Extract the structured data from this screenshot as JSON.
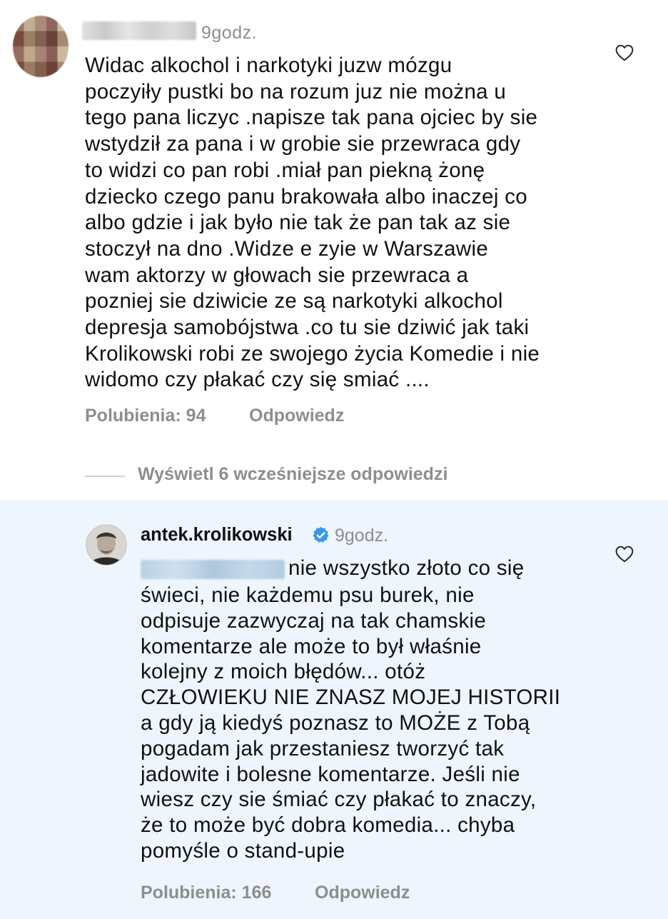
{
  "comment1": {
    "time": "9godz.",
    "lines": [
      "Widac alkochol i narkotyki juzw mózgu",
      "poczyiły pustki bo na rozum juz nie można u",
      "tego pana liczyc .napisze tak pana ojciec by sie",
      "wstydził za pana i w grobie sie przewraca gdy",
      "to widzi co pan robi .miał pan piekną żonę",
      "dziecko czego panu brakowała albo inaczej co",
      "albo gdzie i jak było nie tak że pan tak az sie",
      "stoczył na dno .Widze e zyie w  Warszawie",
      "wam aktorzy w głowach sie przewraca a",
      "pozniej sie dziwicie ze są narkotyki alkochol",
      "depresja samobójstwa .co tu sie dziwić jak taki",
      "Krolikowski robi ze swojego życia Komedie i nie",
      "widomo czy płakać czy się smiać ...."
    ],
    "likes": "Polubienia: 94",
    "reply": "Odpowiedz"
  },
  "view_replies": "Wyświetl 6 wcześniejsze odpowiedzi",
  "comment2": {
    "username": "antek.krolikowski",
    "time": "9godz.",
    "first_line": "nie wszystko złoto co się",
    "lines": [
      "świeci, nie każdemu psu burek, nie",
      "odpisuje zazwyczaj na tak chamskie",
      "komentarze ale może to był właśnie",
      "kolejny z moich błędów... otóż",
      "CZŁOWIEKU NIE ZNASZ MOJEJ HISTORII",
      "a gdy ją kiedyś poznasz to MOŻE z Tobą",
      "pogadam jak przestaniesz tworzyć tak",
      "jadowite i bolesne komentarze.  Jeśli nie",
      "wiesz czy sie śmiać czy płakać to znaczy,",
      "że to może być dobra komedia... chyba",
      "pomyśle o stand-upie"
    ],
    "likes": "Polubienia: 166",
    "reply": "Odpowiedz"
  },
  "colors": {
    "meta_gray": "#8e8e8e",
    "highlight_bg": "#eef5fd",
    "verified_blue": "#3897f0"
  },
  "icons": [
    "heart-icon",
    "verified-badge-icon"
  ]
}
